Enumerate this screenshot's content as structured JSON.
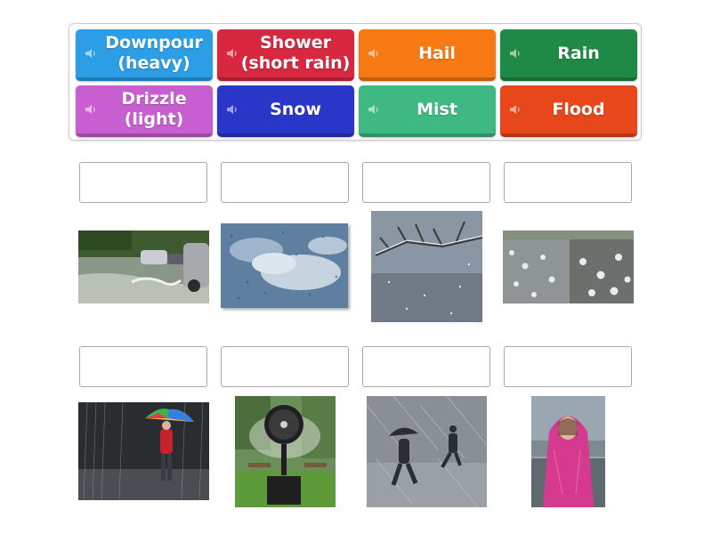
{
  "tiles": [
    {
      "label": "Downpour\n(heavy)",
      "color": "#2b9ee6"
    },
    {
      "label": "Shower\n(short rain)",
      "color": "#d8283f"
    },
    {
      "label": "Hail",
      "color": "#f77914"
    },
    {
      "label": "Rain",
      "color": "#1f8a46"
    },
    {
      "label": "Drizzle\n(light)",
      "color": "#c95ed1"
    },
    {
      "label": "Snow",
      "color": "#2a36c8"
    },
    {
      "label": "Mist",
      "color": "#3fb984"
    },
    {
      "label": "Flood",
      "color": "#e8461b"
    }
  ],
  "images": [
    "flooded-street-photo",
    "raindrops-on-window-photo",
    "snowy-branch-photo",
    "hailstones-photo",
    "woman-with-umbrella-in-downpour-photo",
    "misting-fan-photo",
    "people-walking-in-rain-photo",
    "girl-in-pink-raincoat-photo"
  ]
}
